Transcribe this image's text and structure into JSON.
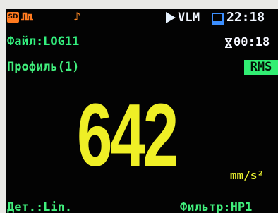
{
  "device_screen": {
    "status_bar": {
      "sd_icon": "sd-card-icon",
      "sd_label": "SD",
      "pulse_icon": "pulse-icon",
      "note_icon": "music-note-icon",
      "note_symbol": "♪",
      "play_icon": "play-icon",
      "mode": "VLM",
      "screen_icon": "screen-icon",
      "time": "22:18"
    },
    "file": {
      "label": "Файл:LOG11",
      "timer_icon": "hourglass-icon",
      "timer_value": "00:18"
    },
    "profile": {
      "label": "Профиль(1)",
      "detector_mode": "RMS"
    },
    "measurement": {
      "value": "642",
      "unit": "mm/s²"
    },
    "footer": {
      "detector": "Дет.:Lin.",
      "filter": "Фильтр:HP1"
    }
  },
  "colors": {
    "background": "#030303",
    "green": "#41f07d",
    "yellow": "#efef26",
    "white": "#f2f7ff",
    "orange": "#ff7a1f",
    "blue": "#3c8fff"
  }
}
